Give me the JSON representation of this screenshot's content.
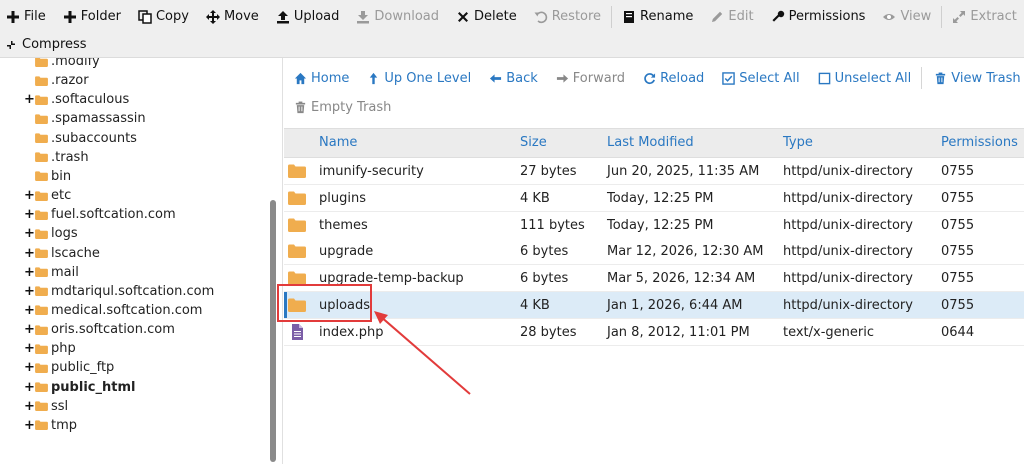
{
  "toolbar": {
    "row1": [
      {
        "label": "File",
        "icon": "plus-icon",
        "disabled": false
      },
      {
        "label": "Folder",
        "icon": "plus-icon",
        "disabled": false
      },
      {
        "label": "Copy",
        "icon": "copy-icon",
        "disabled": false
      },
      {
        "label": "Move",
        "icon": "move-icon",
        "disabled": false
      },
      {
        "label": "Upload",
        "icon": "upload-icon",
        "disabled": false
      },
      {
        "label": "Download",
        "icon": "download-icon",
        "disabled": true
      },
      {
        "label": "Delete",
        "icon": "delete-icon",
        "disabled": false
      },
      {
        "label": "Restore",
        "icon": "restore-icon",
        "disabled": true
      },
      {
        "label": "Rename",
        "icon": "rename-icon",
        "disabled": false
      },
      {
        "label": "Edit",
        "icon": "edit-icon",
        "disabled": true
      },
      {
        "label": "Permissions",
        "icon": "key-icon",
        "disabled": false
      },
      {
        "label": "View",
        "icon": "eye-icon",
        "disabled": true
      },
      {
        "label": "Extract",
        "icon": "extract-icon",
        "disabled": true
      }
    ],
    "row2": [
      {
        "label": "Compress",
        "icon": "compress-icon",
        "disabled": false
      }
    ]
  },
  "tree": {
    "items": [
      {
        "label": ".modify",
        "expander": "",
        "bold": false
      },
      {
        "label": ".razor",
        "expander": "",
        "bold": false
      },
      {
        "label": ".softaculous",
        "expander": "+",
        "bold": false
      },
      {
        "label": ".spamassassin",
        "expander": "",
        "bold": false
      },
      {
        "label": ".subaccounts",
        "expander": "",
        "bold": false
      },
      {
        "label": ".trash",
        "expander": "",
        "bold": false
      },
      {
        "label": "bin",
        "expander": "",
        "bold": false
      },
      {
        "label": "etc",
        "expander": "+",
        "bold": false
      },
      {
        "label": "fuel.softcation.com",
        "expander": "+",
        "bold": false
      },
      {
        "label": "logs",
        "expander": "+",
        "bold": false
      },
      {
        "label": "lscache",
        "expander": "+",
        "bold": false
      },
      {
        "label": "mail",
        "expander": "+",
        "bold": false
      },
      {
        "label": "mdtariqul.softcation.com",
        "expander": "+",
        "bold": false
      },
      {
        "label": "medical.softcation.com",
        "expander": "+",
        "bold": false
      },
      {
        "label": "oris.softcation.com",
        "expander": "+",
        "bold": false
      },
      {
        "label": "php",
        "expander": "+",
        "bold": false
      },
      {
        "label": "public_ftp",
        "expander": "+",
        "bold": false
      },
      {
        "label": "public_html",
        "expander": "+",
        "bold": true
      },
      {
        "label": "ssl",
        "expander": "+",
        "bold": false
      },
      {
        "label": "tmp",
        "expander": "+",
        "bold": false
      }
    ]
  },
  "nav": {
    "row1": [
      {
        "label": "Home",
        "icon": "home-icon",
        "disabled": false
      },
      {
        "label": "Up One Level",
        "icon": "up-arrow-icon",
        "disabled": false
      },
      {
        "label": "Back",
        "icon": "back-arrow-icon",
        "disabled": false
      },
      {
        "label": "Forward",
        "icon": "forward-arrow-icon",
        "disabled": true
      },
      {
        "label": "Reload",
        "icon": "reload-icon",
        "disabled": false
      },
      {
        "label": "Select All",
        "icon": "checked-box-icon",
        "disabled": false
      },
      {
        "label": "Unselect All",
        "icon": "empty-box-icon",
        "disabled": false
      },
      {
        "label": "View Trash",
        "icon": "trash-icon",
        "disabled": false
      }
    ],
    "row2": [
      {
        "label": "Empty Trash",
        "icon": "trash-icon",
        "disabled": true
      }
    ]
  },
  "table": {
    "headers": {
      "name": "Name",
      "size": "Size",
      "modified": "Last Modified",
      "type": "Type",
      "perms": "Permissions"
    },
    "rows": [
      {
        "name": "imunify-security",
        "size": "27 bytes",
        "modified": "Jun 20, 2025, 11:35 AM",
        "type": "httpd/unix-directory",
        "perms": "0755",
        "kind": "folder",
        "selected": false
      },
      {
        "name": "plugins",
        "size": "4 KB",
        "modified": "Today, 12:25 PM",
        "type": "httpd/unix-directory",
        "perms": "0755",
        "kind": "folder",
        "selected": false
      },
      {
        "name": "themes",
        "size": "111 bytes",
        "modified": "Today, 12:25 PM",
        "type": "httpd/unix-directory",
        "perms": "0755",
        "kind": "folder",
        "selected": false
      },
      {
        "name": "upgrade",
        "size": "6 bytes",
        "modified": "Mar 12, 2026, 12:30 AM",
        "type": "httpd/unix-directory",
        "perms": "0755",
        "kind": "folder",
        "selected": false
      },
      {
        "name": "upgrade-temp-backup",
        "size": "6 bytes",
        "modified": "Mar 5, 2026, 12:34 AM",
        "type": "httpd/unix-directory",
        "perms": "0755",
        "kind": "folder",
        "selected": false
      },
      {
        "name": "uploads",
        "size": "4 KB",
        "modified": "Jan 1, 2026, 6:44 AM",
        "type": "httpd/unix-directory",
        "perms": "0755",
        "kind": "folder",
        "selected": true
      },
      {
        "name": "index.php",
        "size": "28 bytes",
        "modified": "Jan 8, 2012, 11:01 PM",
        "type": "text/x-generic",
        "perms": "0644",
        "kind": "file",
        "selected": false
      }
    ]
  },
  "colors": {
    "link": "#2a78c2",
    "folder": "#f0ad4e",
    "file": "#7b5ea7",
    "annotation": "#e23b3b",
    "selected_row": "#dcebf7"
  }
}
